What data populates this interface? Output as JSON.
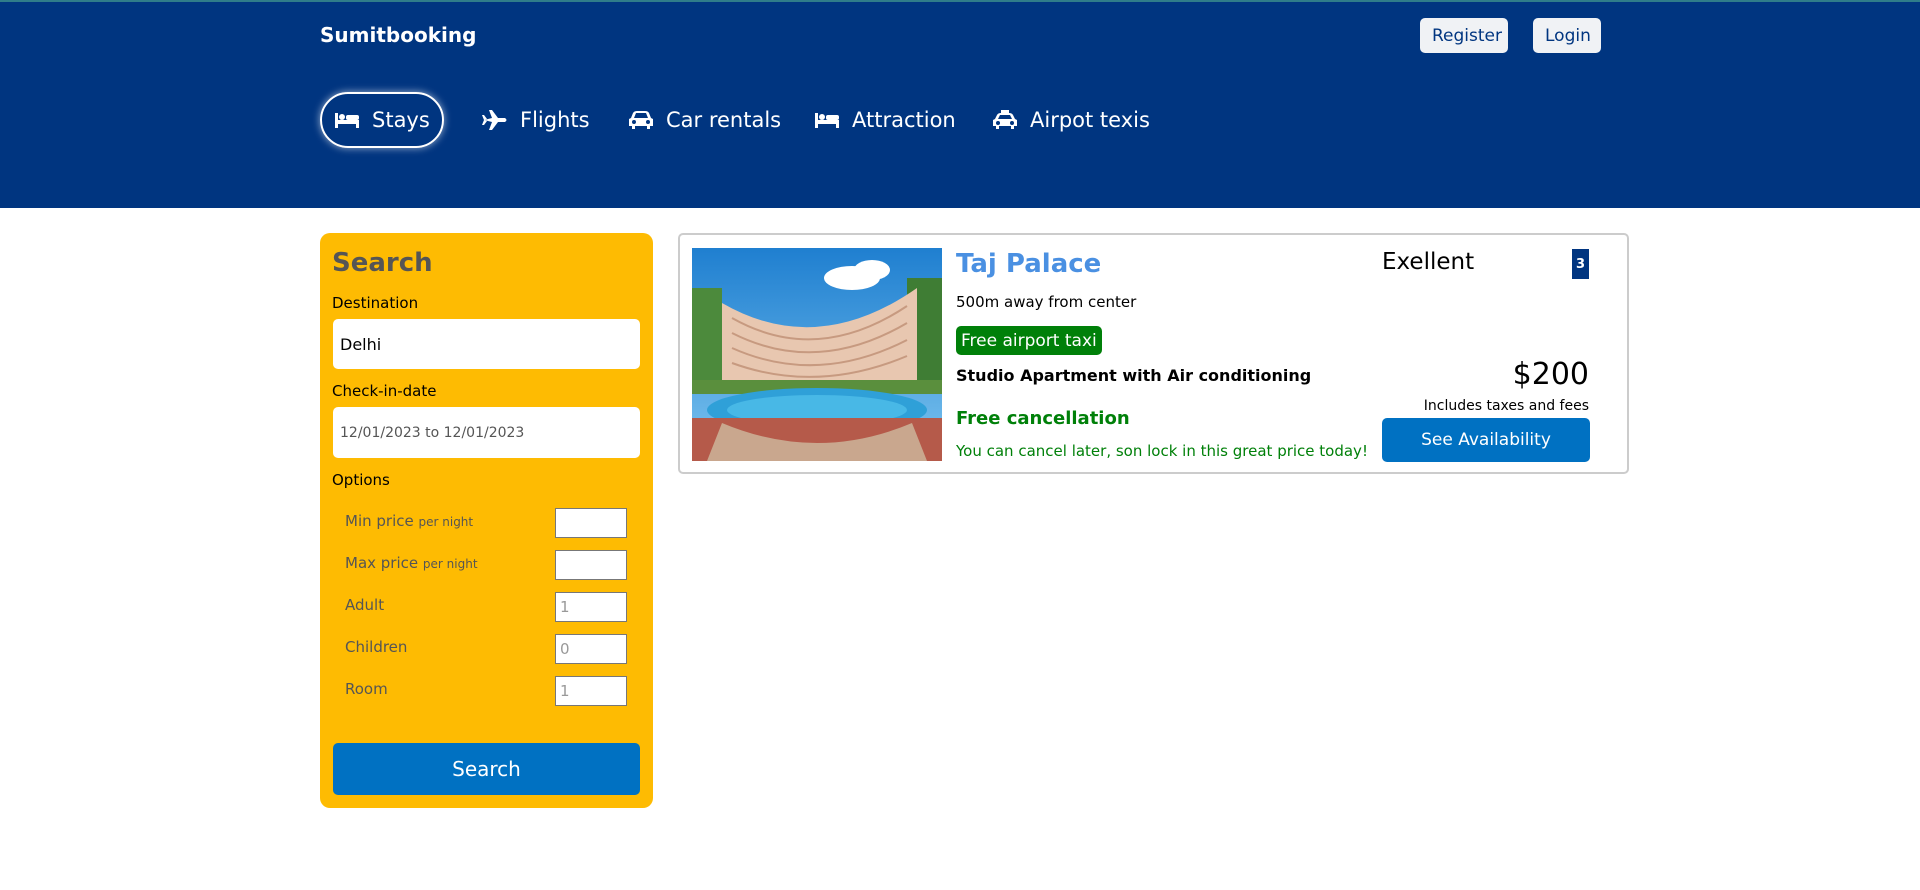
{
  "header": {
    "logo": "Sumitbooking",
    "register_label": "Register",
    "login_label": "Login",
    "nav": [
      {
        "label": "Stays",
        "icon": "bed-icon",
        "active": true
      },
      {
        "label": "Flights",
        "icon": "plane-icon"
      },
      {
        "label": "Car rentals",
        "icon": "car-icon"
      },
      {
        "label": "Attraction",
        "icon": "bed-icon"
      },
      {
        "label": "Airpot texis",
        "icon": "taxi-icon"
      }
    ]
  },
  "search": {
    "title": "Search",
    "destination_label": "Destination",
    "destination_value": "Delhi",
    "checkin_label": "Check-in-date",
    "checkin_value": "12/01/2023 to 12/01/2023",
    "options_label": "Options",
    "options": [
      {
        "label": "Min price",
        "note": "per night",
        "value": ""
      },
      {
        "label": "Max price",
        "note": "per night",
        "value": ""
      },
      {
        "label": "Adult",
        "note": "",
        "value": "1"
      },
      {
        "label": "Children",
        "note": "",
        "value": "0"
      },
      {
        "label": "Room",
        "note": "",
        "value": "1"
      }
    ],
    "button_label": "Search"
  },
  "result": {
    "name": "Taj Palace",
    "distance": "500m away from center",
    "taxi_badge": "Free airport taxi",
    "room": "Studio Apartment with Air conditioning",
    "cancellation": "Free cancellation",
    "cancellation_sub": "You can cancel later, son lock in this great price today!",
    "rating_text": "Exellent",
    "rating_value": "3",
    "price": "$200",
    "taxes": "Includes taxes and fees",
    "button_label": "See Availability"
  },
  "colors": {
    "header_bg": "#003580",
    "sidebar_bg": "#febb02",
    "button_blue": "#0071c2",
    "green": "#008009",
    "hotel_name": "#4a90e2"
  }
}
